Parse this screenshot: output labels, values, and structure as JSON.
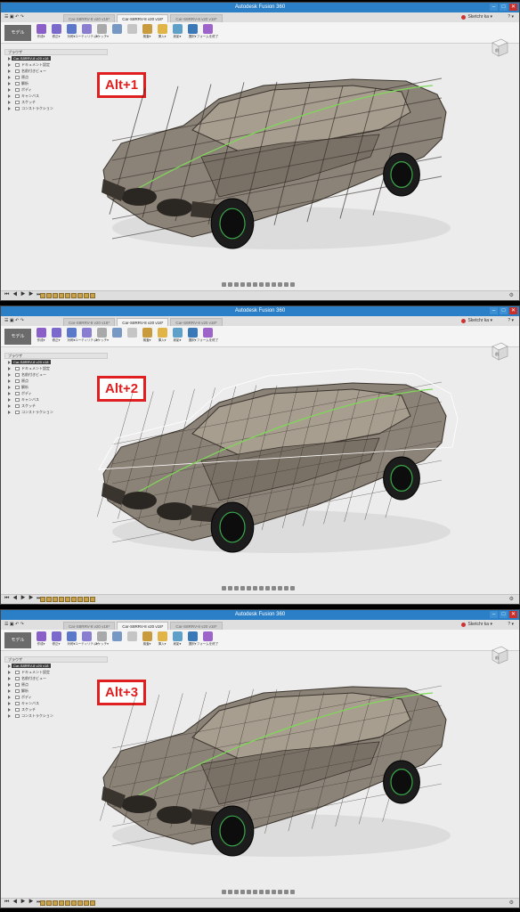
{
  "app_title": "Autodesk Fusion 360",
  "window_controls": [
    "–",
    "□",
    "✕"
  ],
  "quick_access": "☰ ▣ ↶ ↷",
  "user_name": "Sketchr ka ▾",
  "help": "? ▾",
  "tabs": [
    "Car-S8RRV-8 v20 v18*",
    "Car-S8RRV-8 v20 v18*",
    "Car-S8RRV-8 v20 v18*"
  ],
  "workspace": "モデル",
  "toolbar": [
    {
      "label": "作成▾",
      "color": "#8a5fc7"
    },
    {
      "label": "修正▾",
      "color": "#7b6acb"
    },
    {
      "label": "対称▾",
      "color": "#5c78c9"
    },
    {
      "label": "ユーティリティ▾",
      "color": "#8a7ed1"
    },
    {
      "label": "スケッチ▾",
      "color": "#a9a9a9"
    },
    {
      "label": "",
      "color": "#7898c4"
    },
    {
      "label": "",
      "color": "#c5c5c5"
    },
    {
      "label": "検査▾",
      "color": "#c89b3f"
    },
    {
      "label": "挿入▾",
      "color": "#e0b446"
    },
    {
      "label": "射影▾",
      "color": "#5fa0c9"
    },
    {
      "label": "選択▾",
      "color": "#3a78b8"
    },
    {
      "label": "フォームを終了",
      "color": "#9d65c9"
    }
  ],
  "browser": {
    "header": "ブラウザ",
    "root": "Car-S8RRV-8 v20 v18",
    "items": [
      "ドキュメント設定",
      "名前付きビュー",
      "原点",
      "解析",
      "ボディ",
      "キャンバス",
      "スケッチ",
      "コンストラクション"
    ]
  },
  "panels": [
    {
      "badge": "Alt+1",
      "mode": "box"
    },
    {
      "badge": "Alt+2",
      "mode": "control"
    },
    {
      "badge": "Alt+3",
      "mode": "smooth"
    }
  ],
  "viewcube_label": "前",
  "timeline_controls": "⏮ ◀ ▶ ▶ ⏭",
  "settings_icon": "⚙",
  "colors": {
    "titlebar": "#2b7fc6",
    "badge": "#e02020",
    "body": "#8c8378",
    "tire": "#1c1c1c",
    "rim": "#3aa84a"
  }
}
